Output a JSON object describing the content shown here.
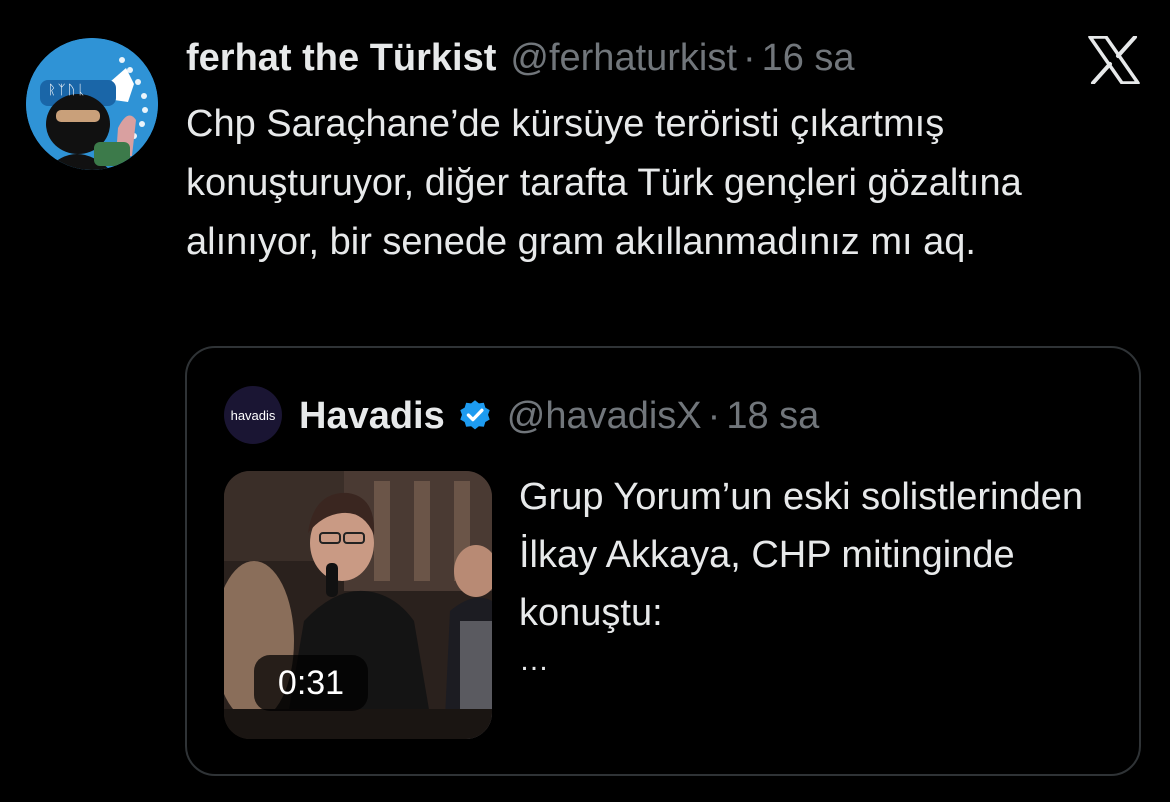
{
  "tweet": {
    "author": {
      "display_name": "ferhat the Türkist",
      "handle": "@ferhaturkist",
      "separator": "·",
      "time": "16 sa",
      "avatar_text": "ᚱᛉᚢᚳ"
    },
    "text": "Chp Saraçhane’de kürsüye teröristi çıkartmış konuşturuyor, diğer tarafta Türk gençleri gözaltına alınıyor, bir senede gram akıllanmadınız mı aq."
  },
  "quote": {
    "author": {
      "display_name": "Havadis",
      "avatar_label": "havadis",
      "handle": "@havadisX",
      "separator": "·",
      "time": "18 sa",
      "verified": true
    },
    "media": {
      "duration": "0:31"
    },
    "text": "Grup Yorum’un eski solistlerinden İlkay Akkaya, CHP mitinginde konuştu:",
    "truncation": "…"
  },
  "icons": {
    "platform": "x-logo-icon",
    "verified": "verified-badge-icon"
  },
  "colors": {
    "background": "#000000",
    "text_primary": "#e7e9ea",
    "text_secondary": "#71767b",
    "verified_blue": "#1d9bf0",
    "border": "#2f3336",
    "avatar_blue": "#2f93d6"
  }
}
